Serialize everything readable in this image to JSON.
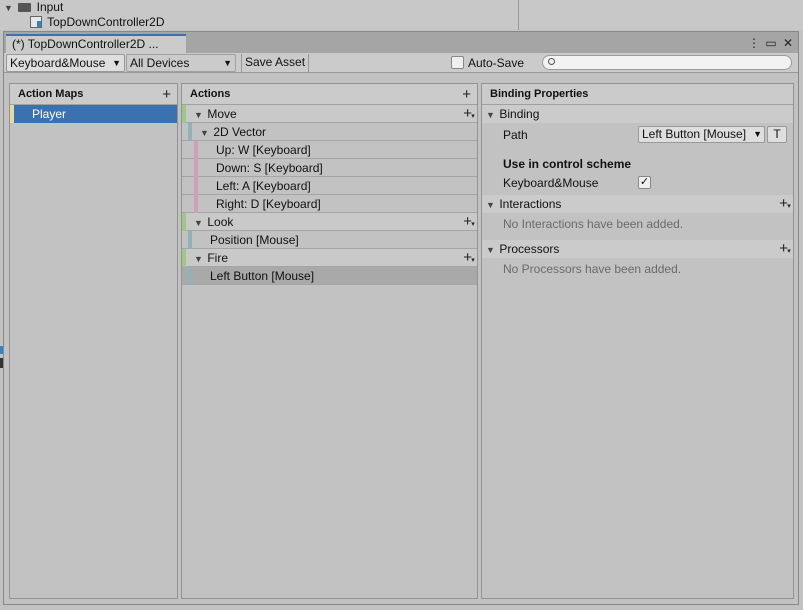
{
  "background": {
    "folder_label": "Input",
    "asset_label": "TopDownController2D"
  },
  "window": {
    "tab_title": "(*) TopDownController2D ...",
    "menu_glyph": "⋮",
    "maximize_glyph": "▭",
    "close_glyph": "✕"
  },
  "toolbar": {
    "control_scheme": "Keyboard&Mouse",
    "device": "All Devices",
    "save_asset": "Save Asset",
    "auto_save": "Auto-Save",
    "auto_save_checked": false,
    "search_placeholder": ""
  },
  "action_maps": {
    "header": "Action Maps",
    "add_glyph": "+",
    "items": [
      {
        "label": "Player",
        "selected": true
      }
    ]
  },
  "actions": {
    "header": "Actions",
    "add_glyph": "+",
    "items": [
      {
        "label": "Move",
        "kind": "action"
      },
      {
        "label": "2D Vector",
        "kind": "composite"
      },
      {
        "label": "Up: W [Keyboard]",
        "kind": "part"
      },
      {
        "label": "Down: S [Keyboard]",
        "kind": "part"
      },
      {
        "label": "Left: A [Keyboard]",
        "kind": "part"
      },
      {
        "label": "Right: D [Keyboard]",
        "kind": "part"
      },
      {
        "label": "Look",
        "kind": "action"
      },
      {
        "label": "Position [Mouse]",
        "kind": "binding"
      },
      {
        "label": "Fire",
        "kind": "action"
      },
      {
        "label": "Left Button [Mouse]",
        "kind": "binding",
        "selected": true
      }
    ],
    "colors": {
      "action": "#9fc78a",
      "composite": "#8fb3b8",
      "part": "#cfa0b9",
      "binding": "#8fb3b8"
    }
  },
  "binding_properties": {
    "header": "Binding Properties",
    "binding_section": "Binding",
    "path_label": "Path",
    "path_value": "Left Button [Mouse]",
    "path_t_button": "T",
    "use_in_scheme_title": "Use in control scheme",
    "scheme_name": "Keyboard&Mouse",
    "scheme_checked": true,
    "interactions_section": "Interactions",
    "interactions_empty": "No Interactions have been added.",
    "processors_section": "Processors",
    "processors_empty": "No Processors have been added."
  },
  "colors": {
    "selection": "#3a72b0",
    "selected_row": "#a9a9a9",
    "player_marker": "#e8d9a0"
  }
}
